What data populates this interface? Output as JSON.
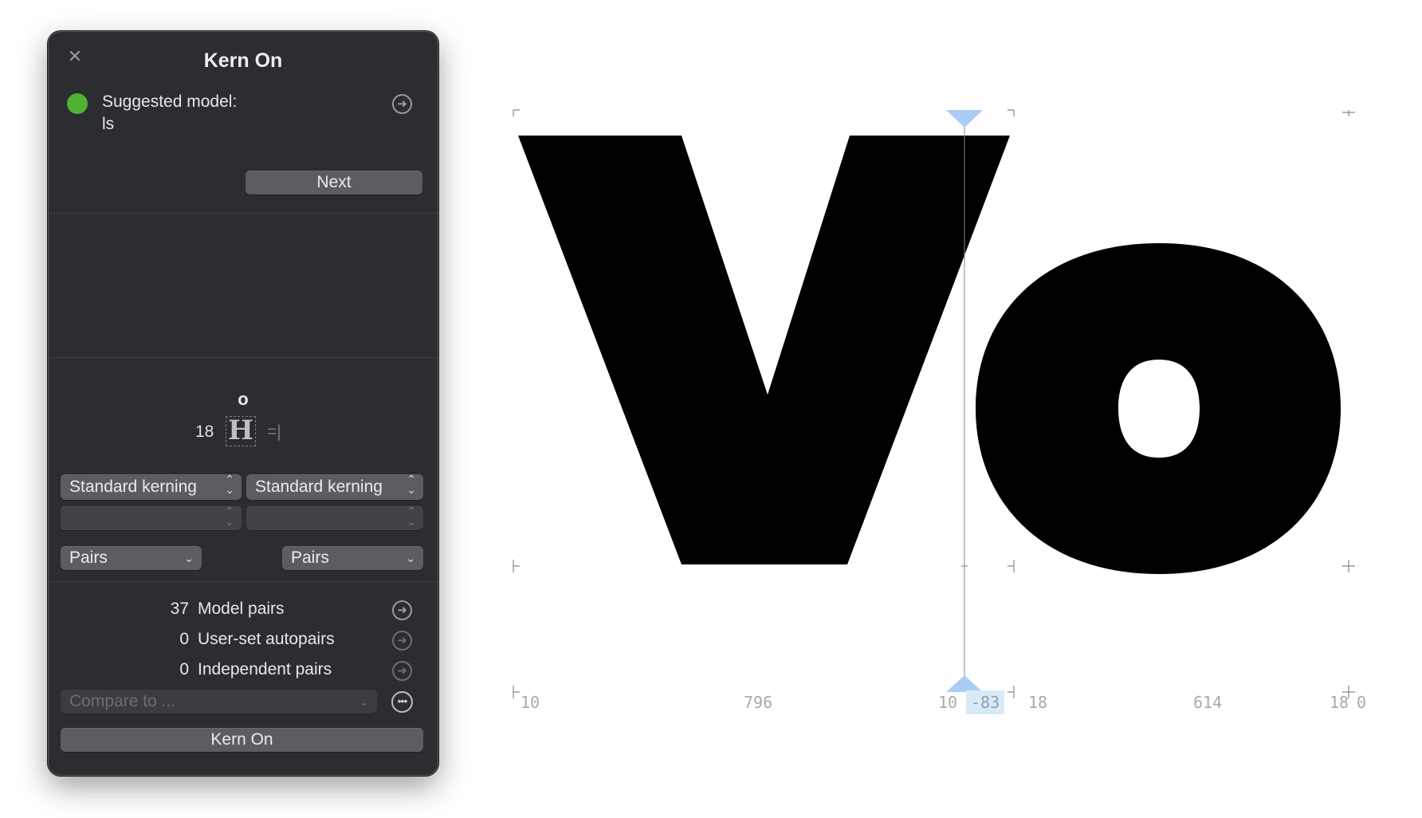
{
  "panel": {
    "title": "Kern On",
    "close_icon": "close-icon",
    "status_color": "#4fb233",
    "suggested_label": "Suggested model:",
    "suggested_value": "ls",
    "next_label": "Next",
    "pair_right_glyph": "o",
    "pair_value": "18",
    "pair_left_glyph": "H",
    "pair_suffix": "=|",
    "kerning_left": "Standard kerning",
    "kerning_right": "Standard kerning",
    "filter_left": "Pairs",
    "filter_right": "Pairs",
    "stats": [
      {
        "count": "37",
        "label": "Model pairs"
      },
      {
        "count": "0",
        "label": "User-set autopairs"
      },
      {
        "count": "0",
        "label": "Independent pairs"
      }
    ],
    "compare_placeholder": "Compare to ...",
    "kern_on_label": "Kern On"
  },
  "canvas": {
    "glyphs": "Vo",
    "metrics": {
      "v_lsb": "10",
      "v_width": "796",
      "v_rsb": "10",
      "kern": "-83",
      "o_lsb": "18",
      "o_width": "614",
      "o_rsb": "18",
      "end": "0"
    },
    "highlight_color": "#d9eaf7",
    "marker_color": "#a9cdf5"
  }
}
